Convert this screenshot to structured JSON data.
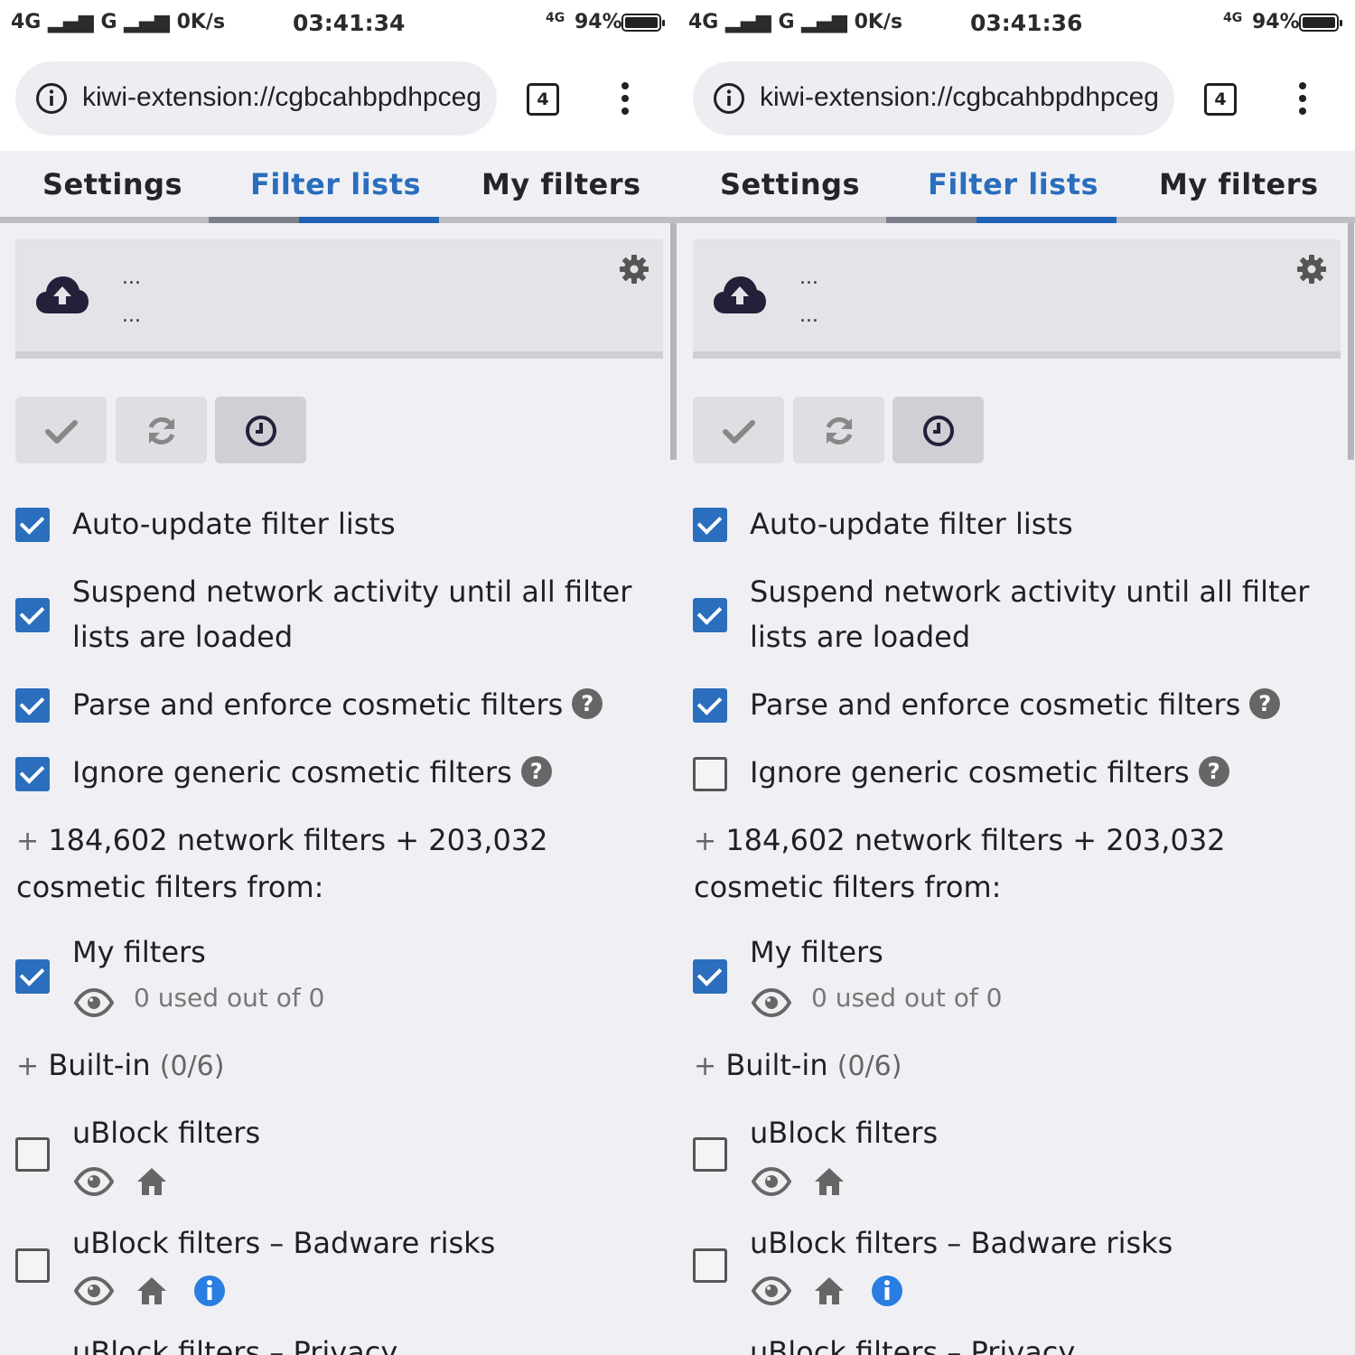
{
  "panels": [
    {
      "status": {
        "left": "4G ▂▄▆ G ▂▄▆ 0K/s",
        "time": "03:41:34",
        "network": "4G",
        "battery": "94%"
      },
      "url": {
        "text": "kiwi-extension://cgbcahbpdhpceg",
        "tab_count": "4"
      },
      "tabs": [
        "Settings",
        "Filter lists",
        "My filters"
      ],
      "card": {
        "line1": "...",
        "line2": "..."
      },
      "options": [
        {
          "label": "Auto-update filter lists",
          "checked": true
        },
        {
          "label_1": "Suspend network activity until all filter",
          "label_2": "lists are loaded",
          "checked": true
        },
        {
          "label": "Parse and enforce cosmetic filters",
          "checked": true,
          "help": "?"
        },
        {
          "label": "Ignore generic cosmetic filters",
          "checked": true,
          "help": "?"
        }
      ],
      "counts": {
        "line1": "184,602 network filters  +  203,032",
        "line2": "cosmetic filters from:",
        "plus": "+"
      },
      "my_filters": {
        "label": "My filters",
        "used": "0 used out of 0",
        "checked": true
      },
      "builtin": {
        "label": "Built-in",
        "count": "(0/6)",
        "plus": "+"
      },
      "lists": [
        {
          "name": "uBlock filters",
          "checked": false
        },
        {
          "name": "uBlock filters – Badware risks",
          "checked": false
        },
        {
          "name": "uBlock filters – Privacy",
          "checked": false
        }
      ]
    },
    {
      "status": {
        "left": "4G ▂▄▆ G ▂▄▆ 0K/s",
        "time": "03:41:36",
        "network": "4G",
        "battery": "94%"
      },
      "url": {
        "text": "kiwi-extension://cgbcahbpdhpceg",
        "tab_count": "4"
      },
      "tabs": [
        "Settings",
        "Filter lists",
        "My filters"
      ],
      "card": {
        "line1": "...",
        "line2": "..."
      },
      "options": [
        {
          "label": "Auto-update filter lists",
          "checked": true
        },
        {
          "label_1": "Suspend network activity until all filter",
          "label_2": "lists are loaded",
          "checked": true
        },
        {
          "label": "Parse and enforce cosmetic filters",
          "checked": true,
          "help": "?"
        },
        {
          "label": "Ignore generic cosmetic filters",
          "checked": false,
          "help": "?"
        }
      ],
      "counts": {
        "line1": "184,602 network filters  +  203,032",
        "line2": "cosmetic filters from:",
        "plus": "+"
      },
      "my_filters": {
        "label": "My filters",
        "used": "0 used out of 0",
        "checked": true
      },
      "builtin": {
        "label": "Built-in",
        "count": "(0/6)",
        "plus": "+"
      },
      "lists": [
        {
          "name": "uBlock filters",
          "checked": false
        },
        {
          "name": "uBlock filters – Badware risks",
          "checked": false
        },
        {
          "name": "uBlock filters – Privacy",
          "checked": false
        }
      ]
    }
  ],
  "colors": {
    "accent": "#2a6ebd",
    "background": "#f0f0f4",
    "info": "#2a7de1"
  },
  "icons": [
    "info-icon",
    "menu-dots-icon",
    "cloud-upload-icon",
    "gear-icon",
    "checkmark-icon",
    "refresh-icon",
    "clock-icon",
    "help-icon",
    "eye-icon",
    "home-icon",
    "info-circle-icon"
  ]
}
